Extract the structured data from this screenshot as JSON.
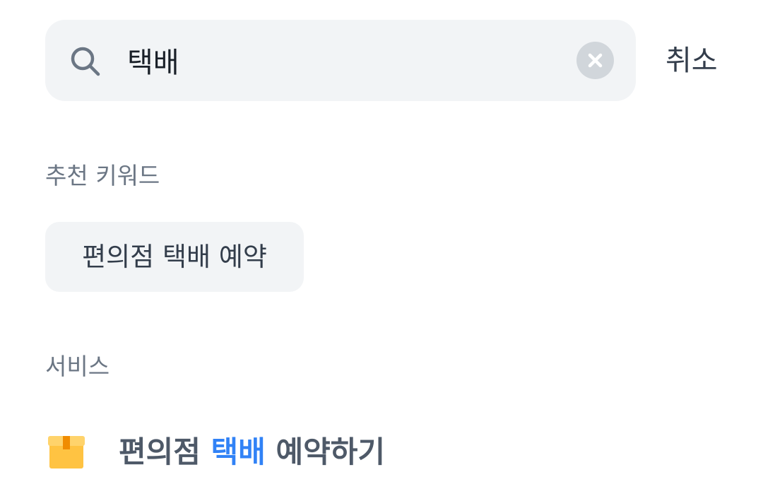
{
  "search": {
    "query": "택배",
    "placeholder": "",
    "cancel_label": "취소",
    "icon": "search-icon",
    "clear_icon": "close-icon"
  },
  "recommended": {
    "title": "추천 키워드",
    "keywords": [
      {
        "label": "편의점 택배 예약"
      }
    ]
  },
  "services": {
    "title": "서비스",
    "items": [
      {
        "icon": "package-box-icon",
        "prefix": "편의점 ",
        "match": "택배",
        "suffix": " 예약하기"
      }
    ]
  },
  "colors": {
    "highlight": "#3182f6",
    "search_bg": "#f2f4f6",
    "section_title": "#6b7684",
    "service_text": "#4e5968",
    "box_icon": "#ffc342",
    "box_tape": "#f08c00"
  }
}
